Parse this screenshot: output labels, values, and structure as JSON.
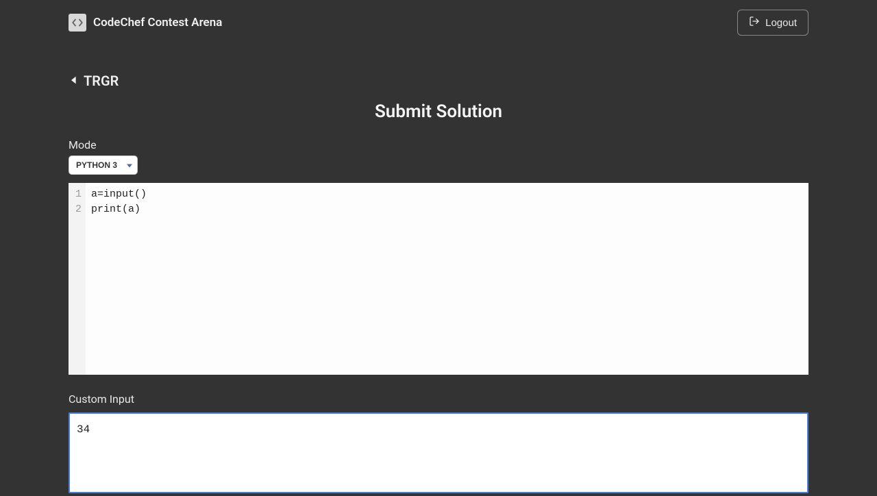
{
  "header": {
    "brand_title": "CodeChef Contest Arena",
    "logout_label": "Logout"
  },
  "back": {
    "label": "TRGR"
  },
  "page": {
    "title": "Submit Solution"
  },
  "mode": {
    "label": "Mode",
    "selected": "PYTHON 3"
  },
  "editor": {
    "lines": [
      {
        "n": "1",
        "text": "a=input()"
      },
      {
        "n": "2",
        "text": "print(a)"
      }
    ]
  },
  "custom_input": {
    "label": "Custom Input",
    "value": "34"
  }
}
